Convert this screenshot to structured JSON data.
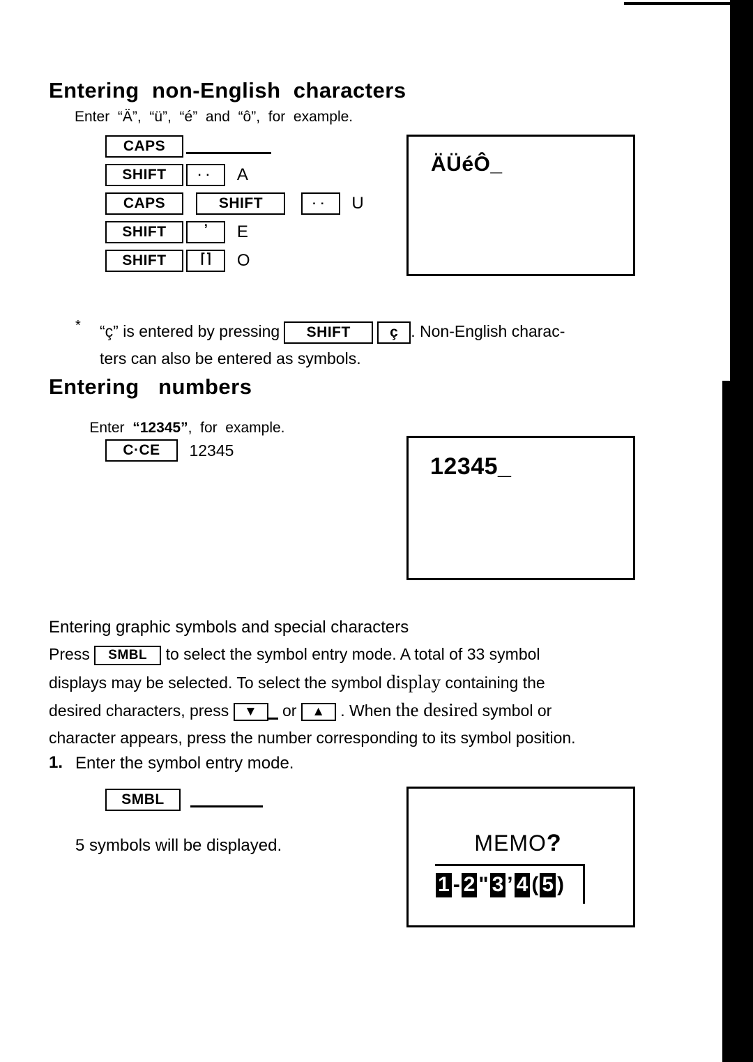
{
  "page": {
    "sections": [
      {
        "id": "non-english",
        "heading": "Entering  non-English  characters",
        "intro": "Enter  “Ä”,  “ü”,  “é”  and  “ô”,  for  example.",
        "key_sequences": [
          {
            "keys": [
              "CAPS"
            ],
            "result": ""
          },
          {
            "keys": [
              "SHIFT",
              "¨"
            ],
            "result": "A"
          },
          {
            "keys": [
              "CAPS",
              "SHIFT",
              "¨"
            ],
            "result": "U"
          },
          {
            "keys": [
              "SHIFT",
              "´"
            ],
            "result": "E"
          },
          {
            "keys": [
              "SHIFT",
              "^"
            ],
            "result": "O"
          }
        ],
        "display": {
          "line1": "ÄÜéÔ_"
        },
        "footnote": {
          "marker": "*",
          "part1": "“ç” is entered by pressing",
          "key1": "SHIFT",
          "key2": "ç",
          "part2": ". Non-English charac-",
          "line2": "ters  can  also  be  entered  as  symbols."
        }
      },
      {
        "id": "numbers",
        "heading": "Entering   numbers",
        "intro_pre": "Enter  ",
        "intro_value": "“12345”",
        "intro_post": ",  for  example.",
        "key_sequence": {
          "key": "C·CE",
          "result": "12345"
        },
        "display": {
          "line1": "12345_"
        }
      },
      {
        "id": "graphic-symbols",
        "heading": "Entering  graphic  symbols  and  special  characters",
        "body_lines": [
          [
            {
              "t": "Press ",
              "style": "sans"
            },
            {
              "t": "SMBL",
              "style": "key"
            },
            {
              "t": " to select the symbol entry mode. A total of 33 symbol",
              "style": "sans"
            }
          ],
          [
            {
              "t": "displays may be selected. To select the symbol ",
              "style": "sans"
            },
            {
              "t": "display",
              "style": "serif"
            },
            {
              "t": " containing the",
              "style": "sans"
            }
          ],
          [
            {
              "t": "desired  characters,  press ",
              "style": "sans"
            },
            {
              "t": "▼",
              "style": "key"
            },
            {
              "t": " or ",
              "style": "sans"
            },
            {
              "t": "▲",
              "style": "key"
            },
            {
              "t": " . When ",
              "style": "sans"
            },
            {
              "t": "the  desired",
              "style": "serif"
            },
            {
              "t": " symbol  or",
              "style": "sans"
            }
          ],
          [
            {
              "t": "character  appears,  press  the  number  corresponding  to  its  symbol  position.",
              "style": "sans"
            }
          ]
        ],
        "step": {
          "number": "1.",
          "text": "Enter  the  symbol  entry  mode.",
          "key": "SMBL",
          "caption": "5  symbols  will  be  displayed."
        },
        "display": {
          "title": "MEMO",
          "title_suffix": "?",
          "symbols": [
            {
              "position": "1",
              "char": "-"
            },
            {
              "position": "2",
              "char": "\""
            },
            {
              "position": "3",
              "char": "’"
            },
            {
              "position": "4",
              "char": "("
            },
            {
              "position": "5",
              "char": ")"
            }
          ]
        }
      }
    ]
  },
  "colors": {
    "ink": "#000000",
    "paper": "#ffffff"
  }
}
